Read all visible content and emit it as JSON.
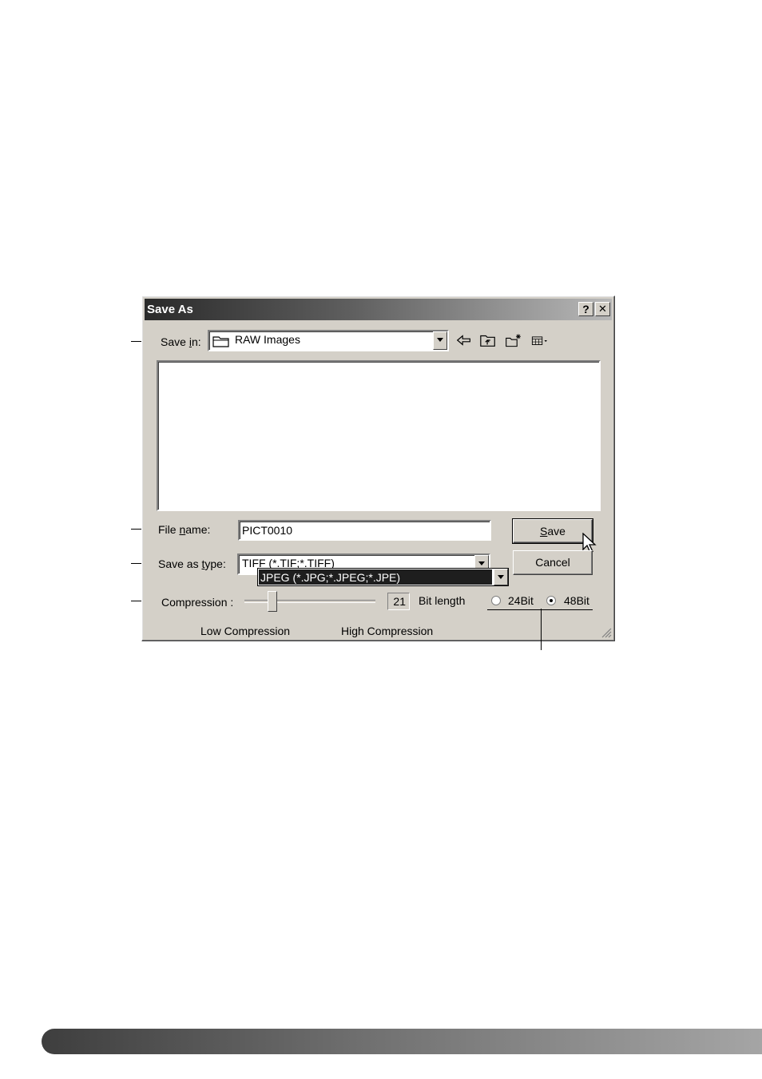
{
  "dialog": {
    "title": "Save As",
    "help_button": "?",
    "close_button": "✕"
  },
  "save_in": {
    "label_pre": "Save ",
    "label_access": "i",
    "label_post": "n:",
    "value": "RAW Images"
  },
  "file_name": {
    "label_pre": "File ",
    "label_access": "n",
    "label_post": "ame:",
    "value": "PICT0010"
  },
  "save_as_type": {
    "label_pre": "Save as ",
    "label_access": "t",
    "label_post": "ype:",
    "value": "TIFF (*.TIF;*.TIFF)",
    "dropdown_selected": "JPEG (*.JPG;*.JPEG;*.JPE)"
  },
  "buttons": {
    "save_access": "S",
    "save_rest": "ave",
    "cancel": "Cancel"
  },
  "compression": {
    "label": "Compression :",
    "value": "21",
    "value_fraction": 0.21,
    "low_label": "Low Compression",
    "high_label": "High Compression"
  },
  "bit_length": {
    "label": "Bit length",
    "option_24": "24Bit",
    "option_48": "48Bit",
    "selected": "48Bit"
  },
  "icons": {
    "folder": "folder-icon",
    "back": "back-arrow-icon",
    "up": "up-folder-icon",
    "new_folder": "new-folder-icon",
    "view_menu": "view-menu-icon",
    "cursor": "mouse-pointer-icon"
  },
  "colors": {
    "title_gradient_start": "#2a2a2a",
    "dialog_face": "#d4d0c8",
    "selection": "#1e1e1e",
    "footer_bar": "#707070"
  }
}
